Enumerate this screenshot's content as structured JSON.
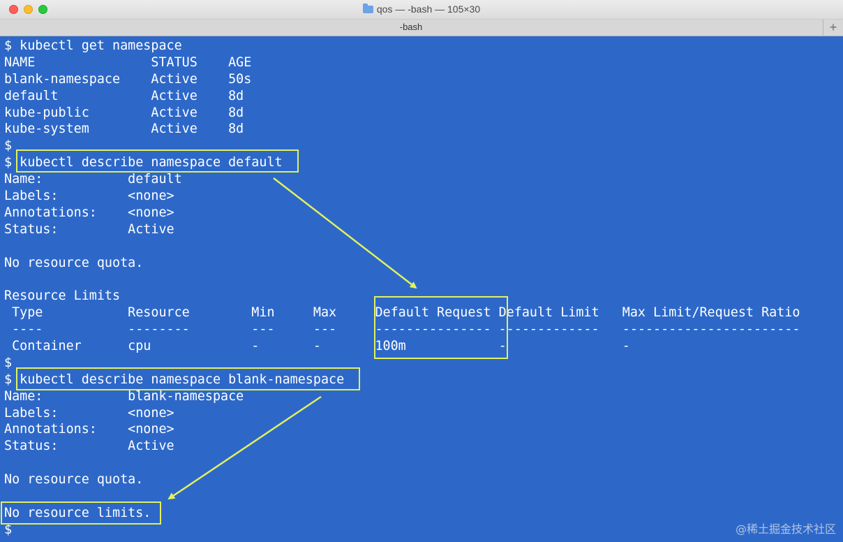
{
  "window": {
    "title": "qos — -bash — 105×30",
    "tab_label": "-bash",
    "new_tab_symbol": "+",
    "icon": "folder-icon"
  },
  "terminal": {
    "lines": [
      "$ kubectl get namespace",
      "NAME               STATUS    AGE",
      "blank-namespace    Active    50s",
      "default            Active    8d",
      "kube-public        Active    8d",
      "kube-system        Active    8d",
      "$",
      "$ kubectl describe namespace default",
      "Name:           default",
      "Labels:         <none>",
      "Annotations:    <none>",
      "Status:         Active",
      "",
      "No resource quota.",
      "",
      "Resource Limits",
      " Type           Resource        Min     Max     Default Request Default Limit   Max Limit/Request Ratio",
      " ----           --------        ---     ---     --------------- -------------   -----------------------",
      " Container      cpu             -       -       100m            -               -",
      "$",
      "$ kubectl describe namespace blank-namespace",
      "Name:           blank-namespace",
      "Labels:         <none>",
      "Annotations:    <none>",
      "Status:         Active",
      "",
      "No resource quota.",
      "",
      "No resource limits.",
      "$"
    ]
  },
  "annotation_color": "#e2f05e",
  "background_color": "#2d68c9",
  "watermark": "@稀土掘金技术社区"
}
